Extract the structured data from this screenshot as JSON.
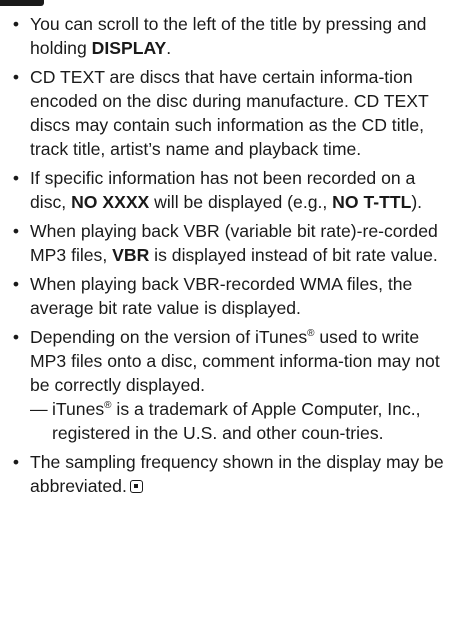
{
  "bullet_glyph": "•",
  "dash_glyph": "—",
  "notes": [
    {
      "pre": "You can scroll to the left of the title by pressing and holding ",
      "bold": "DISPLAY",
      "post": "."
    },
    {
      "text": "CD TEXT are discs that have certain informa-tion encoded on the disc during manufacture. CD TEXT discs may contain such information as the CD title, track title, artist’s name and playback time."
    },
    {
      "pre": "If specific information has not been recorded on a disc, ",
      "bold": "NO XXXX",
      "mid": " will be displayed (e.g., ",
      "bold2": "NO T-TTL",
      "post": ")."
    },
    {
      "pre": "When playing back VBR (variable bit rate)-re-corded MP3 files, ",
      "bold": "VBR",
      "post": " is displayed instead of bit rate value."
    },
    {
      "text": "When playing back VBR-recorded WMA files, the average bit rate value is displayed."
    },
    {
      "pre": "Depending on the version of iTunes",
      "sup": "®",
      "post": " used to write MP3 files onto a disc, comment informa-tion may not be correctly displayed.",
      "sub_pre": "iTunes",
      "sub_sup": "®",
      "sub_post": " is a trademark of Apple Computer, Inc., registered in the U.S. and other coun-tries."
    },
    {
      "text": "The sampling frequency shown in the display may be abbreviated."
    }
  ],
  "icons": {
    "top_mark": "section-tab-mark",
    "end_mark": "end-of-section-icon"
  }
}
